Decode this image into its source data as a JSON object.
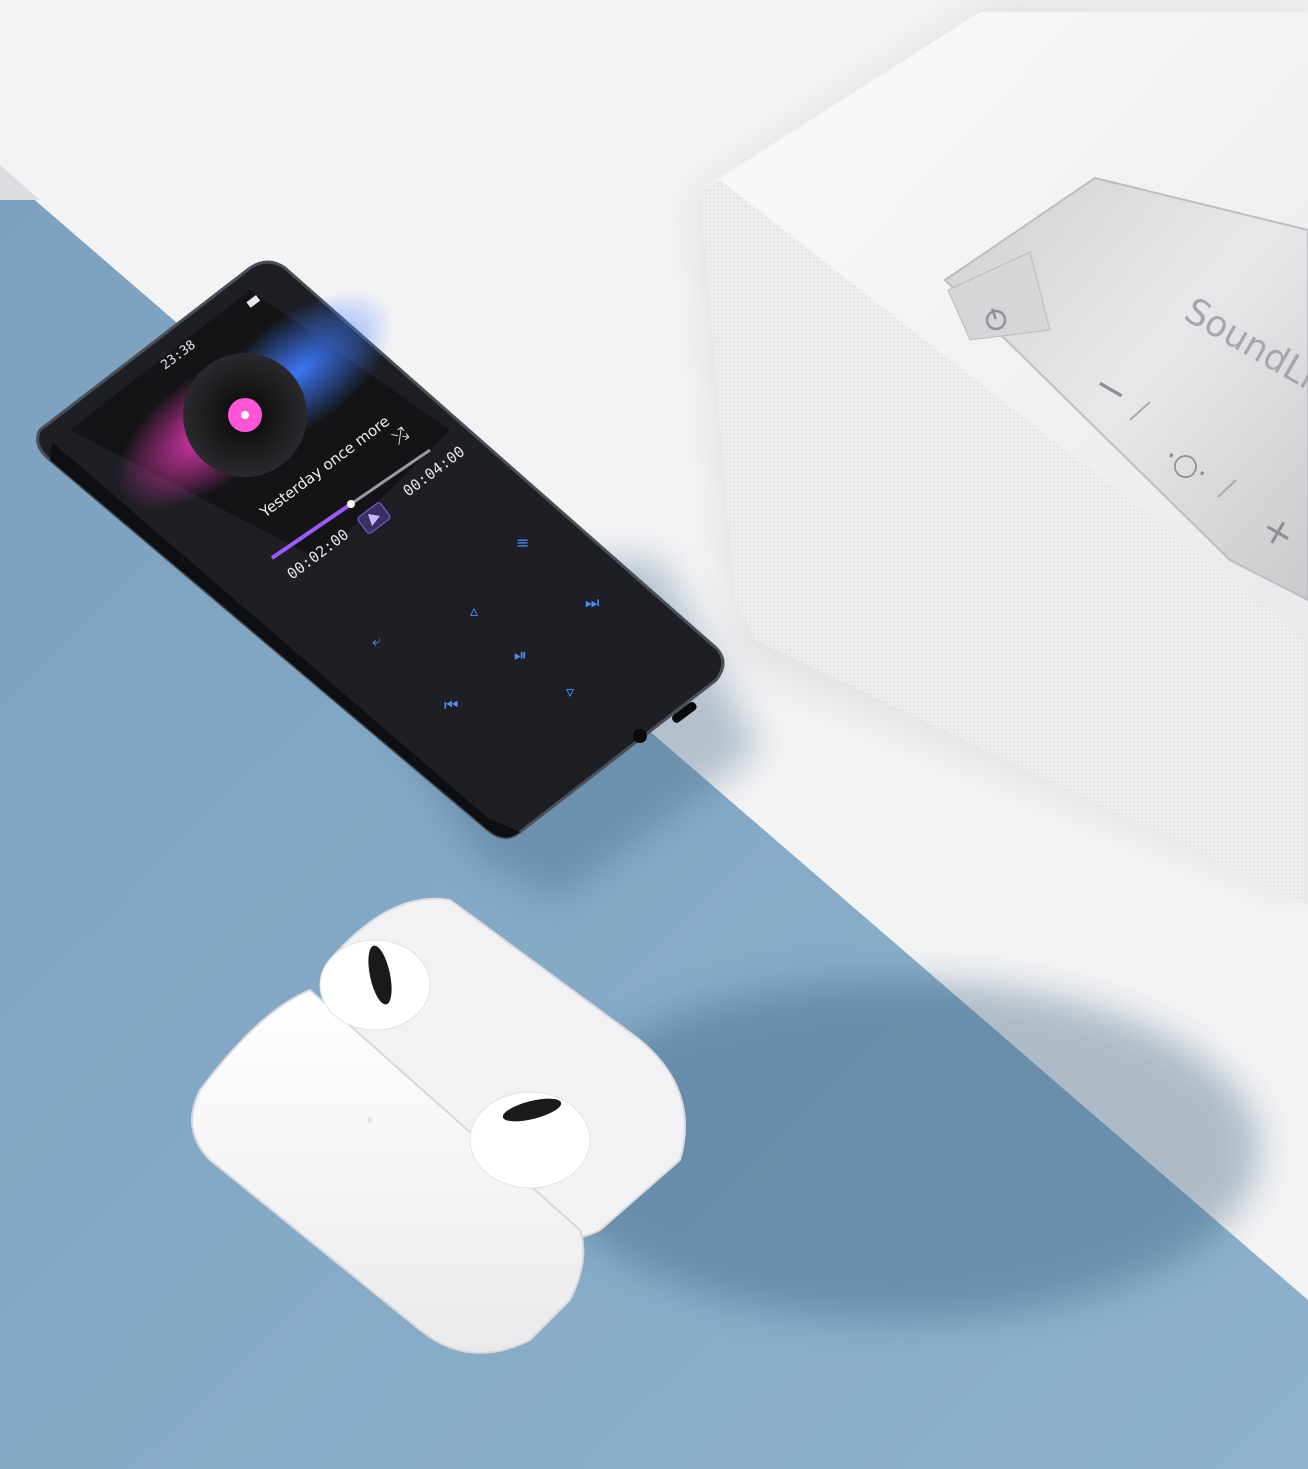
{
  "player": {
    "clock": "23:38",
    "song_title": "Yesterday once more",
    "elapsed_time": "00:02:00",
    "total_time": "00:04:00",
    "progress": 0.5
  },
  "speaker": {
    "brand_text": "SoundLin",
    "buttons": [
      {
        "name": "power",
        "icon": "power-icon"
      },
      {
        "name": "volume-down",
        "label": "−"
      },
      {
        "name": "bluetooth",
        "label": "·○·"
      },
      {
        "name": "volume-up",
        "label": "+"
      }
    ]
  },
  "colors": {
    "blue_surface": "#86aac6",
    "white_surface": "#f3f3f4",
    "player_body": "#1d1f24",
    "screen_glow_pink": "#ff3ec8",
    "screen_glow_blue": "#3d7bff",
    "touch_key_blue": "#4f8dff"
  }
}
